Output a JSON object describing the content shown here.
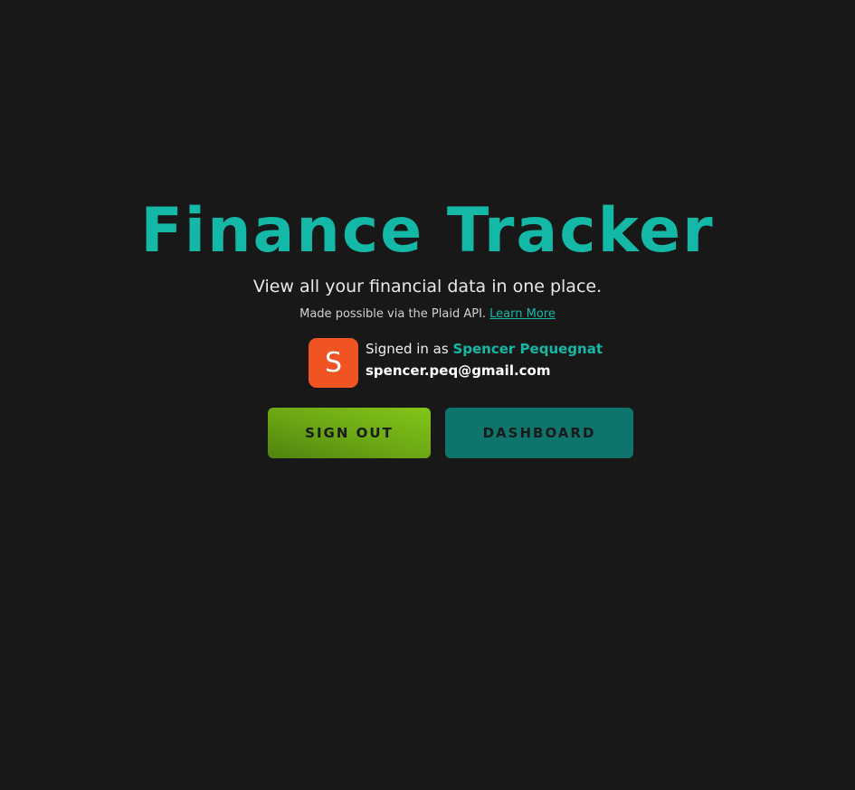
{
  "header": {
    "title": "Finance Tracker",
    "subtitle": "View all your financial data in one place.",
    "credit_text": "Made possible via the Plaid API.",
    "credit_link": "Learn More"
  },
  "user": {
    "avatar_letter": "S",
    "signed_in_prefix": "Signed in as",
    "name": "Spencer Pequegnat",
    "email": "spencer.peq@gmail.com"
  },
  "actions": {
    "sign_out_label": "SIGN OUT",
    "dashboard_label": "DASHBOARD"
  },
  "colors": {
    "background": "#181818",
    "accent": "#14b8a6",
    "avatar": "#f05423",
    "sign_out_button": "#6aa614",
    "dashboard_button": "#0f756c"
  }
}
